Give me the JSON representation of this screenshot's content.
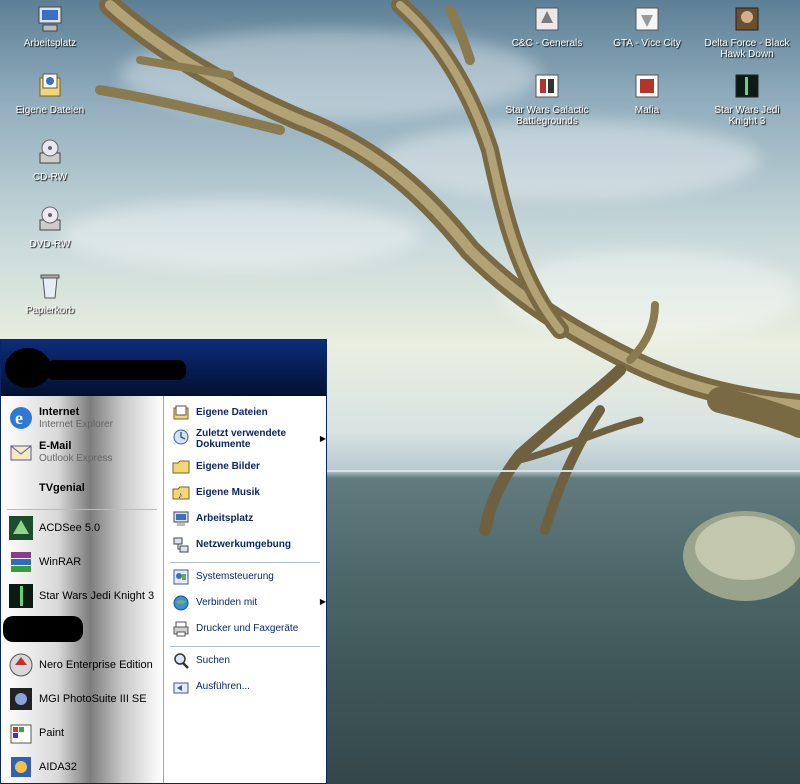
{
  "desktop_icons": [
    {
      "id": "arbeitsplatz",
      "label": "Arbeitsplatz",
      "icon": "computer-icon"
    },
    {
      "id": "eigene-dateien",
      "label": "Eigene Dateien",
      "icon": "documents-icon"
    },
    {
      "id": "cd-rw",
      "label": "CD-RW",
      "icon": "cd-drive-icon"
    },
    {
      "id": "dvd-rw",
      "label": "DVD-RW",
      "icon": "dvd-drive-icon"
    },
    {
      "id": "papierkorb",
      "label": "Papierkorb",
      "icon": "recycle-bin-icon"
    },
    {
      "id": "cnc-generals",
      "label": "C&C - Generals",
      "icon": "game-icon"
    },
    {
      "id": "gta-vice-city",
      "label": "GTA - Vice City",
      "icon": "game-icon"
    },
    {
      "id": "delta-force",
      "label": "Delta Force - Black Hawk Down",
      "icon": "game-icon"
    },
    {
      "id": "star-wars-battlegrounds",
      "label": "Star Wars Galactic Battlegrounds",
      "icon": "game-icon"
    },
    {
      "id": "mafia",
      "label": "Mafia",
      "icon": "game-icon"
    },
    {
      "id": "jedi-knight-3",
      "label": "Star Wars Jedi Knight 3",
      "icon": "game-icon"
    }
  ],
  "start_menu": {
    "pinned": [
      {
        "title": "Internet",
        "subtitle": "Internet Explorer"
      },
      {
        "title": "E-Mail",
        "subtitle": "Outlook Express"
      },
      {
        "title": "TVgenial",
        "subtitle": ""
      }
    ],
    "recent": [
      {
        "label": "ACDSee 5.0"
      },
      {
        "label": "WinRAR"
      },
      {
        "label": "Star Wars Jedi Knight 3"
      },
      {
        "label": "Nero Enterprise Edition"
      },
      {
        "label": "MGI PhotoSuite III SE"
      },
      {
        "label": "Paint"
      },
      {
        "label": "AIDA32"
      }
    ],
    "places": [
      {
        "label": "Eigene Dateien"
      },
      {
        "label": "Zuletzt verwendete Dokumente"
      },
      {
        "label": "Eigene Bilder"
      },
      {
        "label": "Eigene Musik"
      },
      {
        "label": "Arbeitsplatz"
      },
      {
        "label": "Netzwerkumgebung"
      }
    ],
    "system": [
      {
        "label": "Systemsteuerung"
      },
      {
        "label": "Verbinden mit"
      },
      {
        "label": "Drucker und Faxgeräte"
      }
    ],
    "tools": [
      {
        "label": "Suchen"
      },
      {
        "label": "Ausführen..."
      }
    ]
  }
}
